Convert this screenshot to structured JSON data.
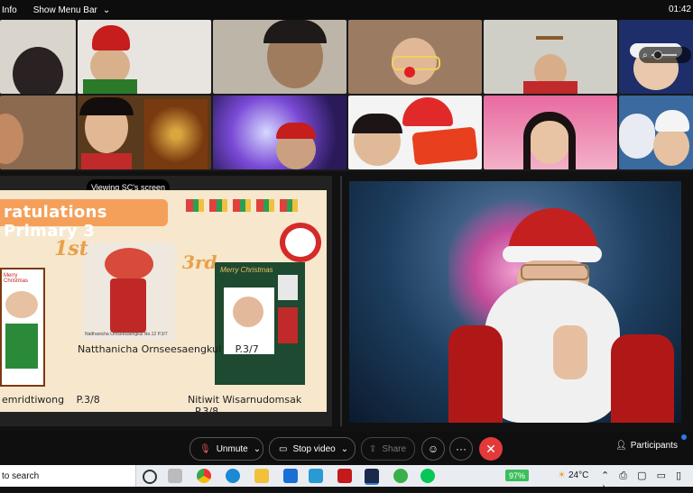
{
  "topbar": {
    "info_label": "Info",
    "menubar_label": "Show Menu Bar",
    "clock": "01:42"
  },
  "share": {
    "viewing_label": "Viewing SC's screen",
    "slide": {
      "banner_title": "ratulations Primary 3",
      "first_rank": "1st",
      "third_rank": "3rd",
      "first_name": "Natthanicha Ornseesaengkul",
      "first_class": "P.3/7",
      "second_name": "emridtiwong",
      "second_class": "P.3/8",
      "third_name": "Nitiwit Wisarnudomsak",
      "third_class": "P.3/8",
      "card_left_title": "Merry Christmas",
      "card_mid_caption": "Natthanicha Ornseesaengkul No.12 P.3/7",
      "card_right_title": "Merry Christmas"
    }
  },
  "controls": {
    "unmute_label": "Unmute",
    "stop_video_label": "Stop video",
    "share_label": "Share",
    "participants_label": "Participants"
  },
  "taskbar": {
    "search_placeholder": "to search",
    "battery": "97%",
    "temperature": "24°C"
  },
  "icons": {
    "mic": "mic-muted-icon",
    "video": "video-camera-icon",
    "share": "share-screen-icon",
    "reactions": "smile-icon",
    "more": "more-dots-icon",
    "end": "close-icon",
    "participants": "person-icon"
  }
}
